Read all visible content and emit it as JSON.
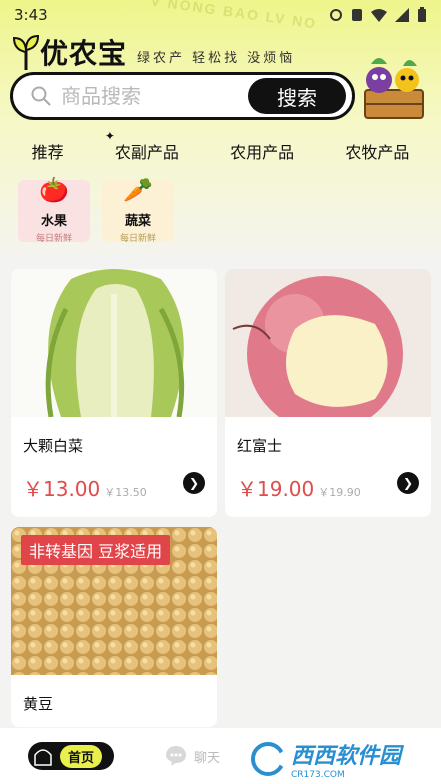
{
  "status": {
    "time": "3:43"
  },
  "brand": {
    "name": "优农宝",
    "slogan": "绿农产 轻松找 没烦恼",
    "watermark": "V NONG BAO LV NO"
  },
  "search": {
    "placeholder": "商品搜索",
    "button_label": "搜索"
  },
  "tabs": [
    {
      "label": "推荐"
    },
    {
      "label": "农副产品",
      "active": true
    },
    {
      "label": "农用产品"
    },
    {
      "label": "农牧产品"
    }
  ],
  "categories": [
    {
      "name": "水果",
      "sub": "每日新鲜",
      "icon": "tomato-icon"
    },
    {
      "name": "蔬菜",
      "sub": "每日新鲜",
      "icon": "carrot-icon"
    }
  ],
  "products": [
    {
      "title": "大颗白菜",
      "price": "￥13.00",
      "old_price": "￥13.50",
      "image": "cabbage"
    },
    {
      "title": "红富士",
      "price": "￥19.00",
      "old_price": "￥19.90",
      "image": "apple"
    },
    {
      "title": "黄豆",
      "price": "",
      "old_price": "",
      "image": "soybean",
      "banner": "非转基因  豆浆适用"
    }
  ],
  "bottom_nav": {
    "home": "首页",
    "chat": "聊天"
  },
  "watermark_logo": {
    "big": "西西软件园",
    "small": "CR173.COM"
  },
  "colors": {
    "accent": "#e9f04b",
    "price": "#e04b4b",
    "dark": "#111111"
  }
}
